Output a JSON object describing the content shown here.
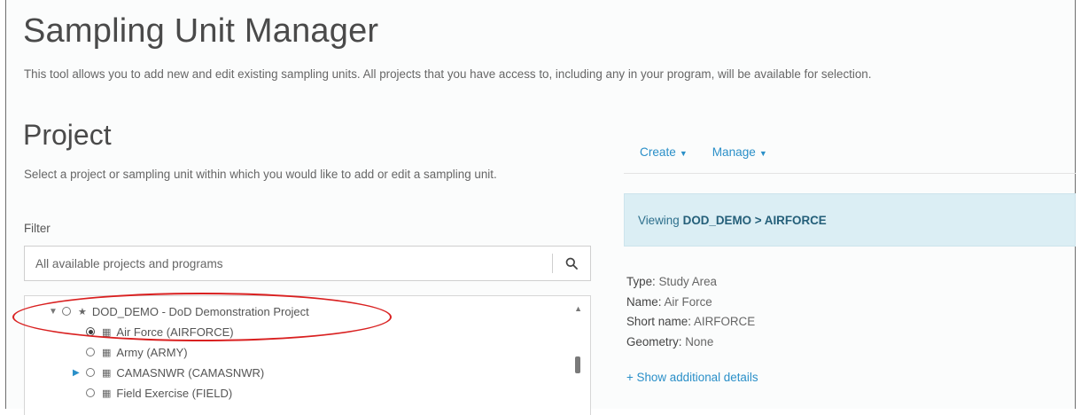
{
  "header": {
    "title": "Sampling Unit Manager",
    "intro": "This tool allows you to add new and edit existing sampling units. All projects that you have access to, including any in your program, will be available for selection."
  },
  "project": {
    "title": "Project",
    "description": "Select a project or sampling unit within which you would like to add or edit a sampling unit.",
    "filter_label": "Filter",
    "search_placeholder": "All available projects and programs",
    "search_icon": "search-icon",
    "tree": [
      {
        "label": "DOD_DEMO - DoD Demonstration Project",
        "toggle": "▼",
        "icon": "star-icon",
        "checked": false,
        "level": 0
      },
      {
        "label": "Air Force (AIRFORCE)",
        "toggle": "",
        "icon": "grid-icon",
        "checked": true,
        "level": 1
      },
      {
        "label": "Army (ARMY)",
        "toggle": "",
        "icon": "grid-icon",
        "checked": false,
        "level": 1
      },
      {
        "label": "CAMASNWR (CAMASNWR)",
        "toggle": "▶",
        "icon": "grid-icon",
        "checked": false,
        "level": 1
      },
      {
        "label": "Field Exercise (FIELD)",
        "toggle": "",
        "icon": "grid-icon",
        "checked": false,
        "level": 1
      }
    ]
  },
  "toolbar": {
    "create_label": "Create",
    "manage_label": "Manage"
  },
  "viewing": {
    "prefix": "Viewing",
    "path": "DOD_DEMO > AIRFORCE"
  },
  "details": {
    "type_label": "Type:",
    "type_value": "Study Area",
    "name_label": "Name:",
    "name_value": "Air Force",
    "short_label": "Short name:",
    "short_value": "AIRFORCE",
    "geometry_label": "Geometry:",
    "geometry_value": "None",
    "more_link": "+ Show additional details"
  },
  "colors": {
    "link": "#2a8fc8",
    "info_bg": "#dbeef4",
    "highlight": "#d92020"
  }
}
